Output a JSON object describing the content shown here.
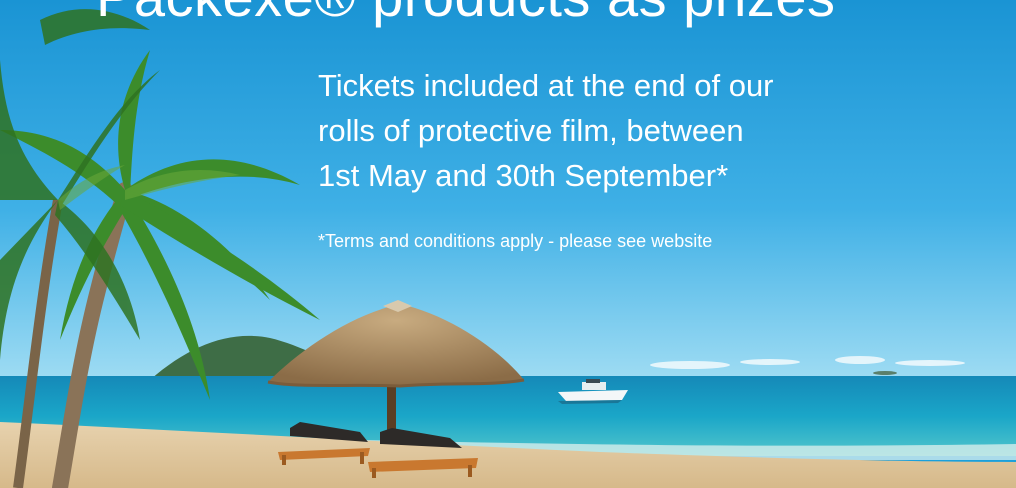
{
  "banner": {
    "headline": "Packexe® products as prizes",
    "subheadline_lines": [
      "Tickets included at the end of our",
      "rolls of protective film, between",
      "1st May and 30th September*"
    ],
    "terms": "*Terms and conditions apply - please see website"
  },
  "scene": {
    "colors": {
      "sky_top": "#1b97d6",
      "sky_bottom": "#7fd0f0",
      "sea": "#16a7c6",
      "sand": "#e9d2ad",
      "palm_green": "#3f8a2a",
      "parasol": "#a98a64"
    }
  }
}
